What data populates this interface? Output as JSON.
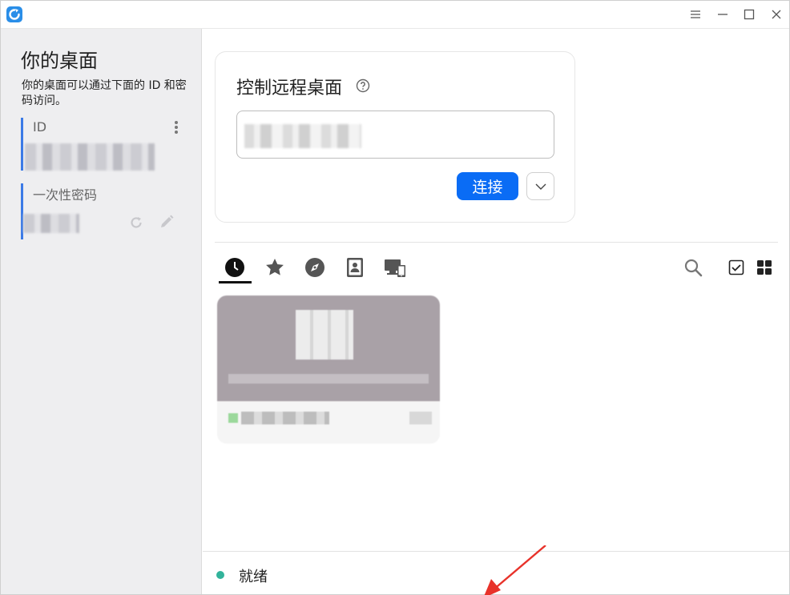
{
  "sidebar": {
    "title": "你的桌面",
    "description": "你的桌面可以通过下面的 ID 和密码访问。",
    "id_label": "ID",
    "password_label": "一次性密码"
  },
  "control": {
    "title": "控制远程桌面",
    "connect_label": "连接"
  },
  "tabs": [
    {
      "icon": "clock-icon",
      "active": true
    },
    {
      "icon": "star-icon",
      "active": false
    },
    {
      "icon": "compass-icon",
      "active": false
    },
    {
      "icon": "address-book-icon",
      "active": false
    },
    {
      "icon": "lan-devices-icon",
      "active": false
    }
  ],
  "status": {
    "text": "就绪",
    "color": "#32b39b"
  },
  "colors": {
    "accent": "#0a6cf5",
    "sidebar_bg": "#eeeef0",
    "annotation": "#e8322a"
  }
}
